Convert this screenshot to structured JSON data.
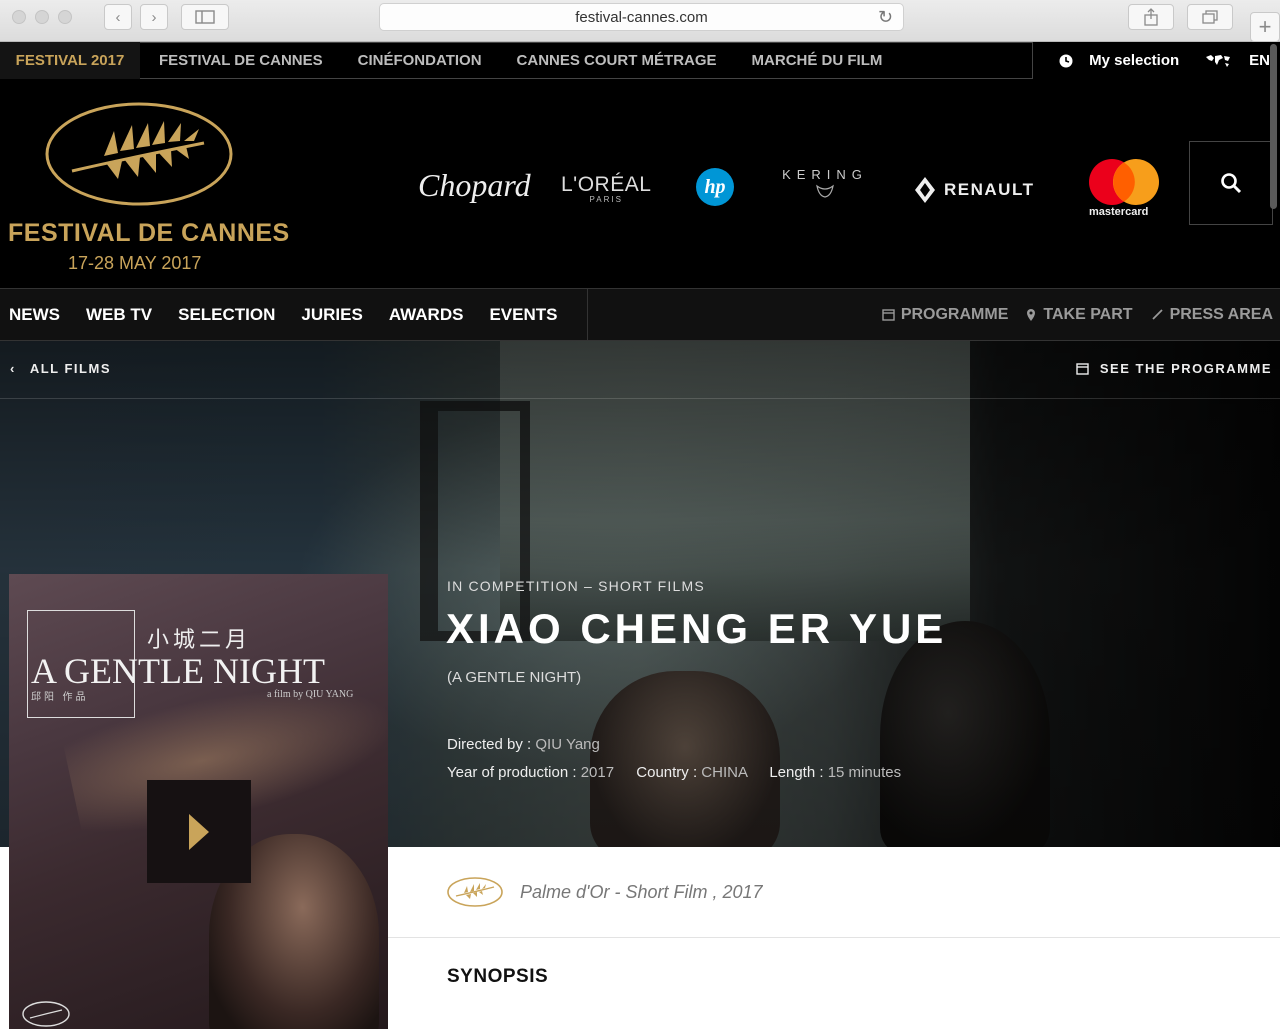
{
  "browser": {
    "url": "festival-cannes.com"
  },
  "topbar": {
    "edition": "FESTIVAL 2017",
    "nav": [
      "FESTIVAL DE CANNES",
      "CINÉFONDATION",
      "CANNES COURT MÉTRAGE",
      "MARCHÉ DU FILM"
    ],
    "my_selection": "My selection",
    "language": "EN"
  },
  "header": {
    "logo_title": "FESTIVAL DE CANNES",
    "logo_dates": "17-28 MAY 2017",
    "sponsors": {
      "chopard": "Chopard",
      "loreal": "L'ORÉAL",
      "loreal_sub": "PARIS",
      "hp": "hp",
      "kering": "KERING",
      "renault": "RENAULT",
      "mastercard": "mastercard"
    }
  },
  "mainnav": {
    "items": [
      "NEWS",
      "WEB TV",
      "SELECTION",
      "JURIES",
      "AWARDS",
      "EVENTS"
    ],
    "right": {
      "programme": "PROGRAMME",
      "take_part": "TAKE PART",
      "press_area": "PRESS AREA"
    }
  },
  "film": {
    "back_link": "ALL FILMS",
    "see_programme": "SEE THE PROGRAMME",
    "category": "IN COMPETITION – SHORT FILMS",
    "title": "XIAO CHENG ER YUE",
    "english_title": "(A GENTLE NIGHT)",
    "directed_label": "Directed by : ",
    "director": "QIU Yang",
    "year_label": "Year of production : ",
    "year": "2017",
    "country_label": "Country : ",
    "country": "CHINA",
    "length_label": "Length : ",
    "length": "15 minutes"
  },
  "poster": {
    "chinese_title": "小城二月",
    "english_title": "A GENTLE NIGHT",
    "credit_cn": "邱阳 作品",
    "credit_en": "a film by QIU YANG"
  },
  "award": {
    "text": "Palme d'Or - Short Film , 2017"
  },
  "synopsis": {
    "heading": "SYNOPSIS"
  },
  "colors": {
    "gold": "#c9a45a",
    "black": "#000000",
    "mastercard_red": "#eb001b",
    "mastercard_orange": "#f79e1b",
    "hp_blue": "#0096d6"
  }
}
